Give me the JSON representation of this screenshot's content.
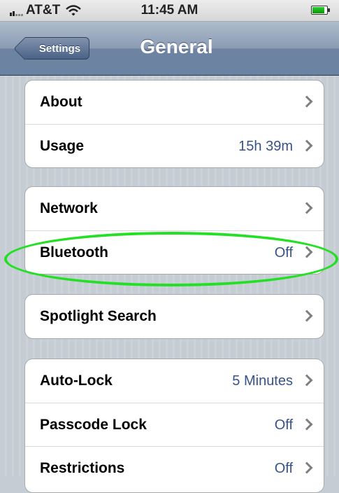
{
  "status_bar": {
    "carrier": "AT&T",
    "time": "11:45 AM"
  },
  "nav": {
    "back_label": "Settings",
    "title": "General"
  },
  "groups": [
    {
      "rows": [
        {
          "label": "About",
          "value": ""
        },
        {
          "label": "Usage",
          "value": "15h 39m"
        }
      ]
    },
    {
      "rows": [
        {
          "label": "Network",
          "value": ""
        },
        {
          "label": "Bluetooth",
          "value": "Off"
        }
      ]
    },
    {
      "rows": [
        {
          "label": "Spotlight Search",
          "value": ""
        }
      ]
    },
    {
      "rows": [
        {
          "label": "Auto-Lock",
          "value": "5 Minutes"
        },
        {
          "label": "Passcode Lock",
          "value": "Off"
        },
        {
          "label": "Restrictions",
          "value": "Off"
        }
      ]
    }
  ],
  "colors": {
    "highlight": "#24e024",
    "value_text": "#385487",
    "nav_bar": "#6d83a1"
  }
}
